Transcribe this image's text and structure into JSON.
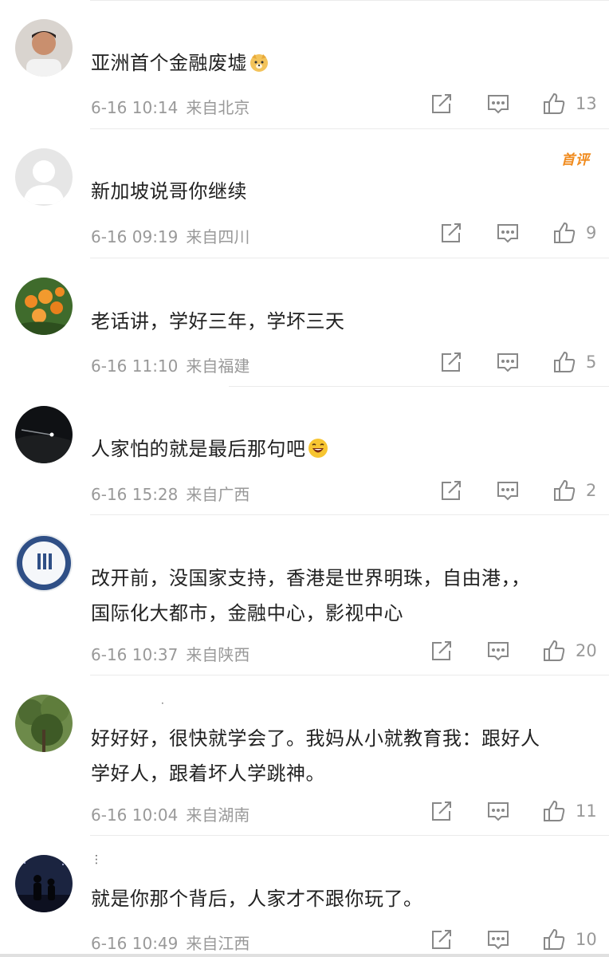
{
  "comments": [
    {
      "text": "亚洲首个金融废墟",
      "emoji": "doge-emoji",
      "time": "6-16 10:14",
      "location": "来自北京",
      "likes": "13",
      "badge": ""
    },
    {
      "text": "新加坡说哥你继续",
      "emoji": "",
      "time": "6-16 09:19",
      "location": "来自四川",
      "likes": "9",
      "badge": "首评"
    },
    {
      "text": "老话讲，学好三年，学坏三天",
      "emoji": "",
      "time": "6-16 11:10",
      "location": "来自福建",
      "likes": "5",
      "badge": ""
    },
    {
      "text": "人家怕的就是最后那句吧",
      "emoji": "laughing-emoji",
      "time": "6-16 15:28",
      "location": "来自广西",
      "likes": "2",
      "badge": ""
    },
    {
      "text_line1": "改开前，没国家支持，香港是世界明珠，自由港，，",
      "text_line2": "国际化大都市，金融中心，影视中心",
      "time": "6-16 10:37",
      "location": "来自陕西",
      "likes": "20",
      "badge": ""
    },
    {
      "text_line1": "好好好，很快就学会了。我妈从小就教育我：跟好人",
      "text_line2": "学好人，跟着坏人学跳神。",
      "time": "6-16 10:04",
      "location": "来自湖南",
      "likes": "11",
      "badge": ""
    },
    {
      "text": "就是你那个背后，人家才不跟你玩了。",
      "emoji": "",
      "time": "6-16 10:49",
      "location": "来自江西",
      "likes": "10",
      "badge": ""
    }
  ],
  "icons": {
    "repost": "share-icon",
    "reply": "comment-icon",
    "like": "thumbs-up-icon"
  },
  "colors": {
    "meta": "#999999",
    "badge": "#f08a1c",
    "divider": "#ebebeb"
  }
}
